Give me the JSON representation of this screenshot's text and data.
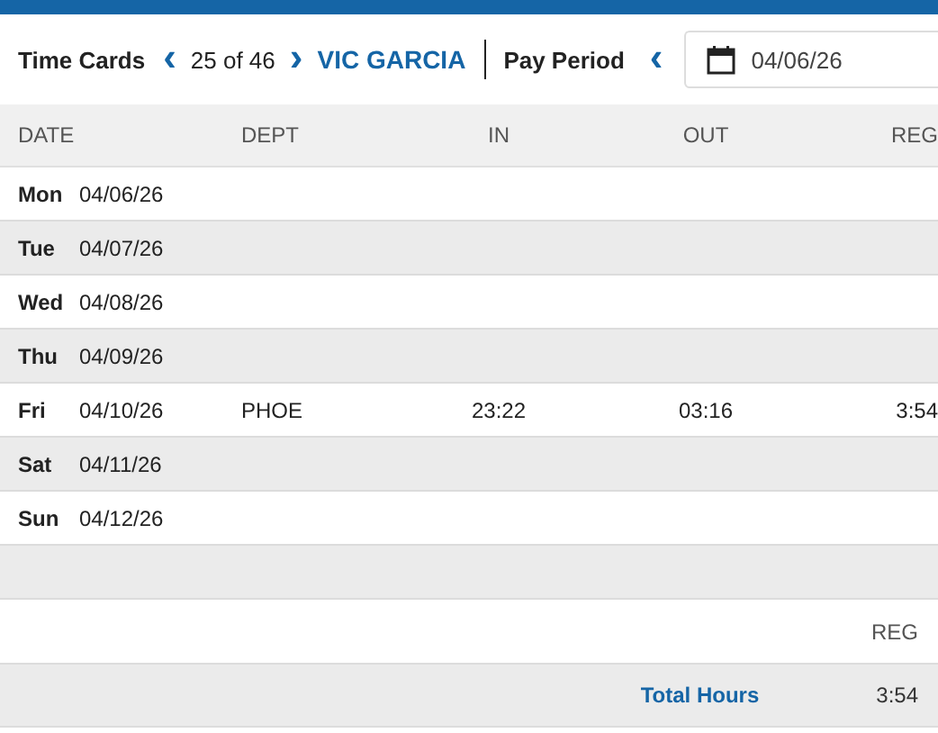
{
  "toolbar": {
    "title": "Time Cards",
    "prev_icon": "‹",
    "position": "25 of 46",
    "next_icon": "›",
    "employee": "VIC GARCIA",
    "period_label": "Pay Period",
    "period_prev_icon": "‹",
    "period_start": "04/06/26"
  },
  "table": {
    "columns": [
      "DATE",
      "DEPT",
      "IN",
      "OUT",
      "REG"
    ],
    "rows": [
      {
        "day": "Mon",
        "date": "04/06/26"
      },
      {
        "day": "Tue",
        "date": "04/07/26"
      },
      {
        "day": "Wed",
        "date": "04/08/26"
      },
      {
        "day": "Thu",
        "date": "04/09/26"
      },
      {
        "day": "Fri",
        "date": "04/10/26",
        "dept": "PHOE",
        "in": "23:22",
        "out": "03:16",
        "reg": "3:54"
      },
      {
        "day": "Sat",
        "date": "04/11/26"
      },
      {
        "day": "Sun",
        "date": "04/12/26"
      }
    ]
  },
  "totals": {
    "column": "REG",
    "label": "Total Hours",
    "value": "3:54"
  }
}
